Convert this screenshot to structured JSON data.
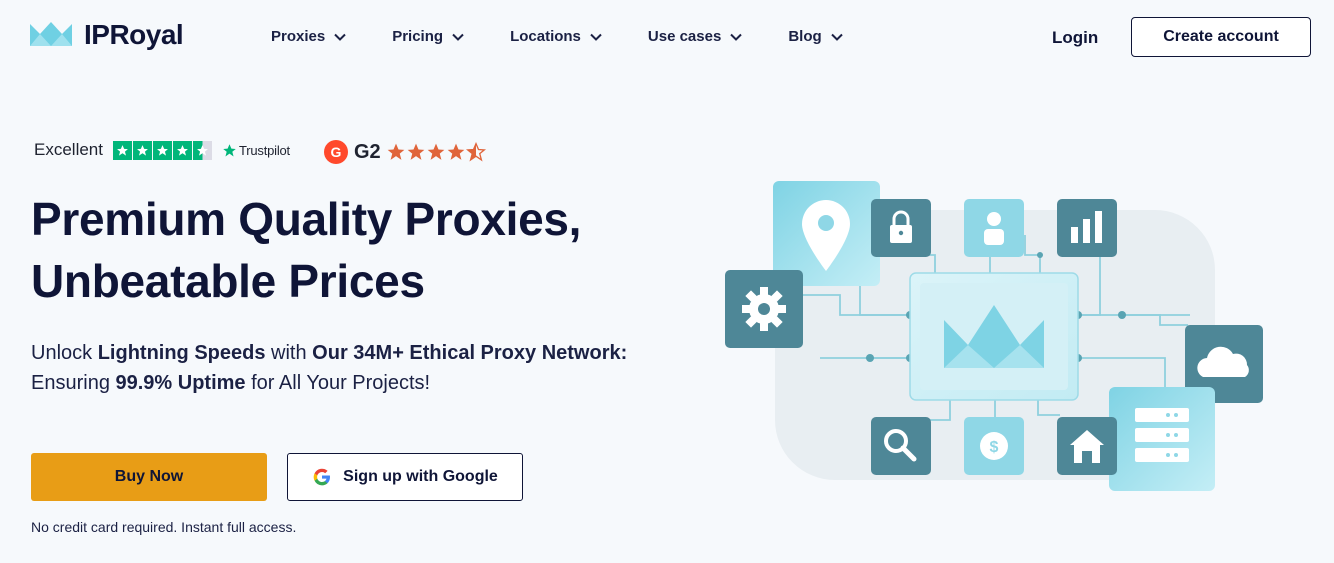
{
  "brand": {
    "name": "IPRoyal"
  },
  "nav": {
    "items": [
      {
        "label": "Proxies"
      },
      {
        "label": "Pricing"
      },
      {
        "label": "Locations"
      },
      {
        "label": "Use cases"
      },
      {
        "label": "Blog"
      }
    ],
    "login_label": "Login",
    "create_account_label": "Create account"
  },
  "ratings": {
    "trustpilot": {
      "label": "Excellent",
      "brand": "Trustpilot",
      "stars": 4.5
    },
    "g2": {
      "brand": "G2",
      "badge": "G",
      "stars": 4.5
    }
  },
  "hero": {
    "headline_line1": "Premium Quality Proxies,",
    "headline_line2": "Unbeatable Prices",
    "sub": {
      "p1": "Unlock ",
      "b1": "Lightning Speeds",
      "p2": " with ",
      "b2": "Our 34M+ Ethical Proxy Network:",
      "p3": " Ensuring ",
      "b3": "99.9% Uptime",
      "p4": " for All Your Projects!"
    },
    "buy_label": "Buy Now",
    "google_label": "Sign up with Google",
    "note": "No credit card required. Instant full access."
  },
  "illustration": {
    "icons": [
      "location-pin-icon",
      "lock-icon",
      "user-icon",
      "bar-chart-icon",
      "gear-icon",
      "cloud-icon",
      "search-icon",
      "dollar-icon",
      "home-icon",
      "server-icon"
    ]
  },
  "colors": {
    "cta": "#e89d16",
    "text": "#0f1537",
    "trustpilot_green": "#00b67a",
    "g2_red": "#ff492c",
    "g2_star": "#e0653b",
    "tile_dark": "#4e8797",
    "tile_light": "#8fd7e6"
  }
}
